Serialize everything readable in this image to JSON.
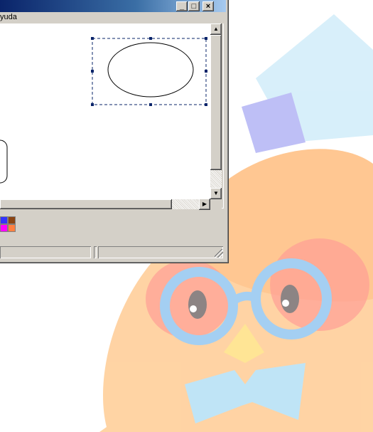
{
  "window": {
    "menu_label": "yuda",
    "title_buttons": {
      "minimize": "_",
      "maximize": "□",
      "close": "×"
    }
  },
  "palette": {
    "colors": [
      "#3333ff",
      "#ff00ff",
      "#8b4513",
      "#ff8040"
    ]
  },
  "background": {
    "mascot_colors": {
      "hat": "#a8d8f0",
      "body": "#ffb060",
      "glasses": "#5aa8e8",
      "bow": "#8ccff0"
    }
  }
}
